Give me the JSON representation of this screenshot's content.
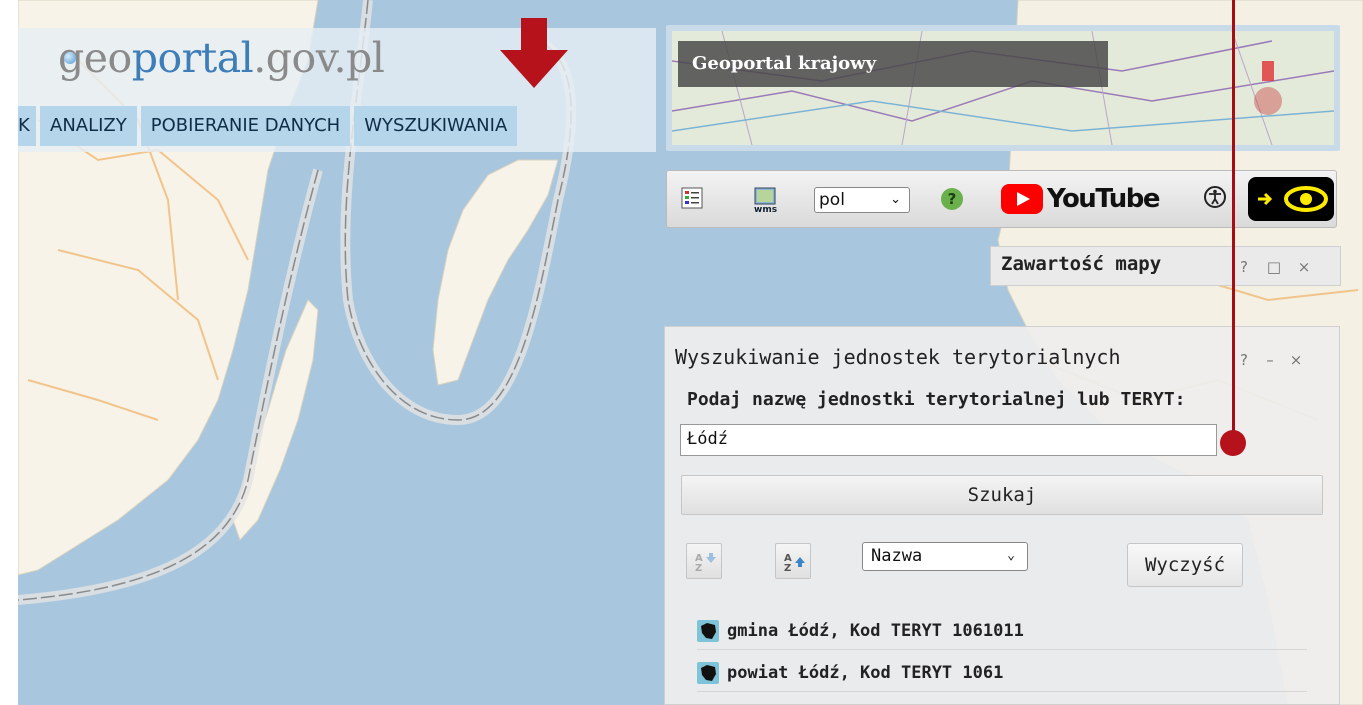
{
  "header": {
    "logo": {
      "part1": "geo",
      "part2": "portal",
      "part3": ".gov.pl"
    },
    "menu": [
      {
        "label": "K"
      },
      {
        "label": "ANALIZY"
      },
      {
        "label": "POBIERANIE DANYCH"
      },
      {
        "label": "WYSZUKIWANIA"
      }
    ]
  },
  "geoportal_krajowy": {
    "label": "Geoportal krajowy"
  },
  "toolbar": {
    "language": "pol",
    "youtube_label": "YouTube",
    "icons": [
      "legend-icon",
      "wms-icon",
      "help-icon",
      "youtube-icon",
      "accessibility-icon",
      "high-contrast-icon"
    ]
  },
  "map_contents": {
    "title": "Zawartość mapy",
    "help": "?",
    "maximize": "□",
    "close": "×"
  },
  "search_panel": {
    "title": "Wyszukiwanie jednostek terytorialnych",
    "help": "?",
    "minimize": "–",
    "close": "×",
    "prompt": "Podaj nazwę jednostki terytorialnej lub TERYT:",
    "query": "Łódź",
    "search_button": "Szukaj",
    "sort_field": "Nazwa",
    "clear_button": "Wyczyść",
    "results": [
      {
        "label": "gmina Łódź, Kod TERYT 1061011"
      },
      {
        "label": "powiat Łódź, Kod TERYT 1061"
      }
    ]
  },
  "colors": {
    "accent_red": "#b5121b",
    "menu_bg": "#b4d5ea",
    "sea": "#a8c6dd"
  }
}
